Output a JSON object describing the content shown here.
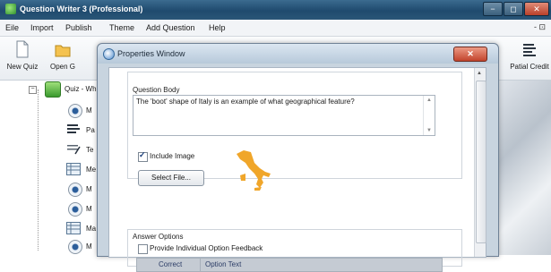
{
  "app": {
    "title": "Question Writer 3 (Professional)",
    "window_controls": [
      "−",
      "◻",
      "✕"
    ],
    "mdi_controls": "- ⊡"
  },
  "menu": {
    "items": [
      {
        "label": "Eile",
        "key": "file"
      },
      {
        "label": "Import",
        "key": "import"
      },
      {
        "label": "Publish",
        "key": "publish"
      },
      {
        "label": "Theme",
        "key": "theme"
      },
      {
        "label": "Add Question",
        "key": "add-question"
      },
      {
        "label": "Help",
        "key": "help"
      }
    ]
  },
  "toolbar": {
    "new_quiz": "New Quiz",
    "open": "Open G",
    "partial_credit": "Patial Credit"
  },
  "tree": {
    "root_label": "Quiz - Wh",
    "items": [
      {
        "icon": "radio",
        "label": "M"
      },
      {
        "icon": "list",
        "label": "Pa"
      },
      {
        "icon": "edit",
        "label": "Te"
      },
      {
        "icon": "grid",
        "label": "Me"
      },
      {
        "icon": "radio",
        "label": "M"
      },
      {
        "icon": "radio",
        "label": "M"
      },
      {
        "icon": "grid",
        "label": "Ma"
      },
      {
        "icon": "radio",
        "label": "M"
      }
    ]
  },
  "dialog": {
    "title": "Properties Window",
    "close_label": "✕",
    "question_body_label": "Question Body",
    "question_text": "The 'boot' shape of Italy is an example of what geographical feature?",
    "include_image_label": "Include Image",
    "include_image_checked": true,
    "select_file_label": "Select File...",
    "answer_options_label": "Answer Options",
    "individual_feedback_label": "Provide Individual Option Feedback",
    "individual_feedback_checked": false,
    "table_headers": [
      "Correct",
      "Option Text"
    ]
  },
  "colors": {
    "italy_map": "#f0a62a",
    "title_bar": "#1f4a6e",
    "dialog_frame": "#c8d4df"
  }
}
